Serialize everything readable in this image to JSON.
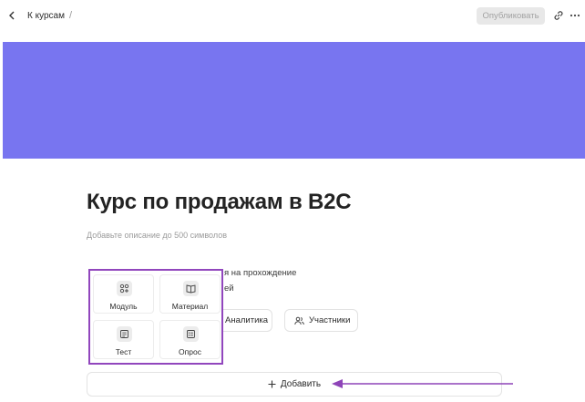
{
  "header": {
    "breadcrumb_label": "К курсам",
    "breadcrumb_separator": "/",
    "publish_label": "Опубликовать"
  },
  "cover": {
    "color": "#7875f0"
  },
  "course": {
    "title": "Курс по продажам в B2C",
    "description_placeholder": "Добавьте описание до 500 символов"
  },
  "settings": {
    "hint_line1": "я на прохождение",
    "hint_line2": "ей"
  },
  "tabs": {
    "analytics_label": "Аналитика",
    "members_label": "Участники"
  },
  "add_menu": {
    "items": [
      {
        "label": "Модуль",
        "icon": "module-icon"
      },
      {
        "label": "Материал",
        "icon": "book-icon"
      },
      {
        "label": "Тест",
        "icon": "test-icon"
      },
      {
        "label": "Опрос",
        "icon": "poll-icon"
      }
    ],
    "highlight_color": "#9146bd"
  },
  "add_button": {
    "label": "Добавить"
  }
}
